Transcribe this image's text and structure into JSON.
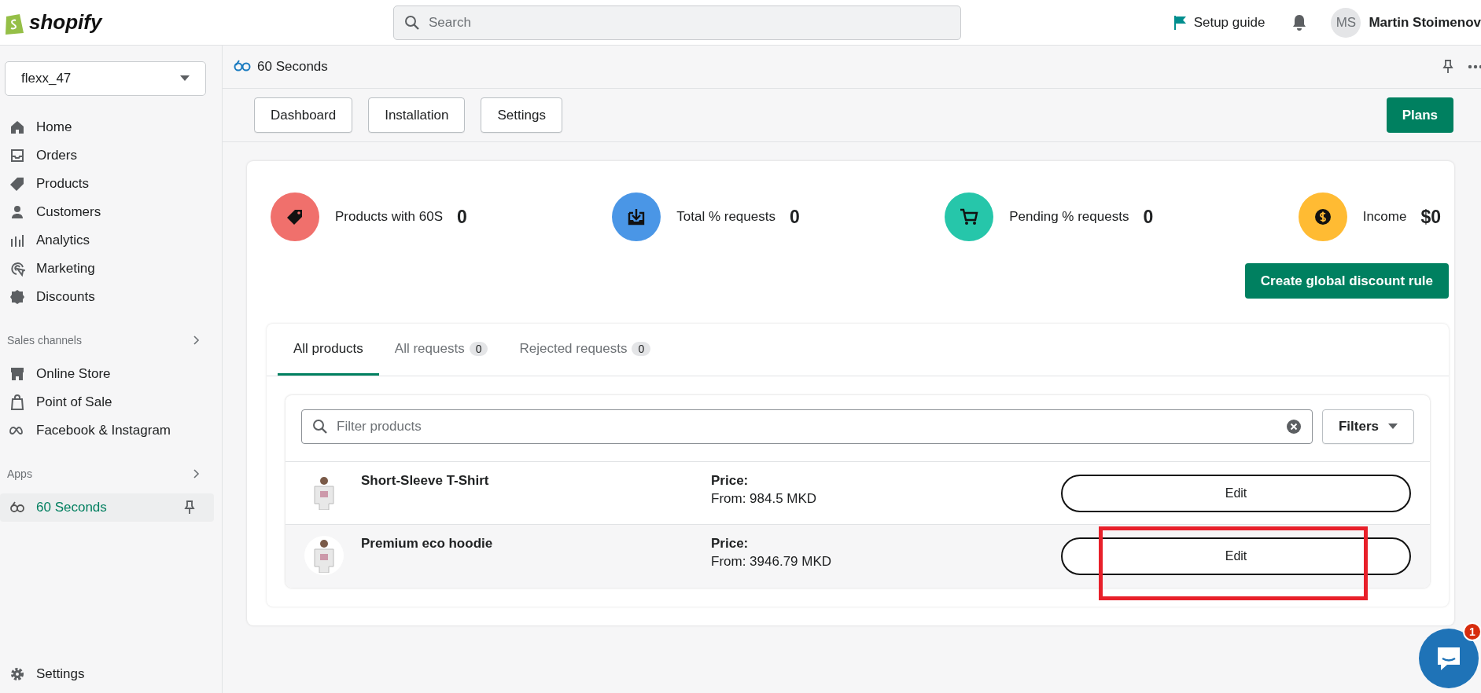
{
  "topbar": {
    "logo": "shopify",
    "search": {
      "placeholder": "Search"
    },
    "setup_guide": "Setup guide",
    "user": {
      "initials": "MS",
      "name": "Martin Stoimenov"
    }
  },
  "sidebar": {
    "store": "flexx_47",
    "items": [
      {
        "label": "Home",
        "selected": false
      },
      {
        "label": "Orders",
        "selected": false
      },
      {
        "label": "Products",
        "selected": false
      },
      {
        "label": "Customers",
        "selected": false
      },
      {
        "label": "Analytics",
        "selected": false
      },
      {
        "label": "Marketing",
        "selected": false
      },
      {
        "label": "Discounts",
        "selected": false
      }
    ],
    "sales_channels": {
      "title": "Sales channels",
      "items": [
        {
          "label": "Online Store",
          "selected": false
        },
        {
          "label": "Point of Sale",
          "selected": false
        },
        {
          "label": "Facebook & Instagram",
          "selected": false
        }
      ]
    },
    "apps": {
      "title": "Apps",
      "items": [
        {
          "label": "60 Seconds",
          "selected": true
        }
      ]
    },
    "settings": "Settings"
  },
  "app_header": {
    "title": "60 Seconds"
  },
  "toolbar": {
    "buttons": [
      "Dashboard",
      "Installation",
      "Settings"
    ],
    "primary": "Plans"
  },
  "stats": [
    {
      "label": "Products with 60S",
      "value": "0",
      "color": "#f0706c"
    },
    {
      "label": "Total % requests",
      "value": "0",
      "color": "#4a96e6"
    },
    {
      "label": "Pending % requests",
      "value": "0",
      "color": "#26c6aa"
    },
    {
      "label": "Income",
      "value": "$0",
      "color": "#ffbb33"
    }
  ],
  "create_button": "Create global discount rule",
  "tabs": [
    {
      "label": "All products",
      "selected": true
    },
    {
      "label": "All requests",
      "count": "0",
      "selected": false
    },
    {
      "label": "Rejected requests",
      "count": "0",
      "selected": false
    }
  ],
  "filter": {
    "placeholder": "Filter products",
    "filters_button": "Filters"
  },
  "products": [
    {
      "name": "Short-Sleeve T-Shirt",
      "price_label": "Price:",
      "price": "From: 984.5 MKD",
      "action": "Edit",
      "highlighted": false
    },
    {
      "name": "Premium eco hoodie",
      "price_label": "Price:",
      "price": "From: 3946.79 MKD",
      "action": "Edit",
      "highlighted": true
    }
  ],
  "chat": {
    "badge": "1"
  }
}
